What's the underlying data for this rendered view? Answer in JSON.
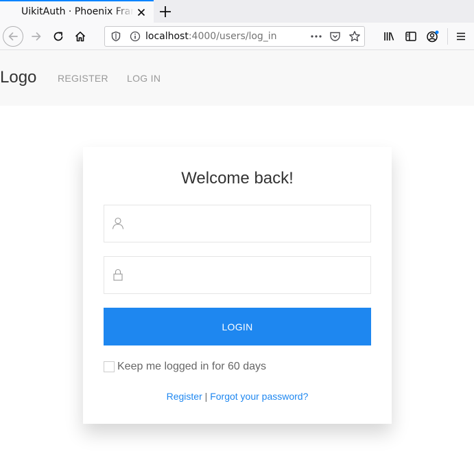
{
  "browser": {
    "tab_title": "UikitAuth · Phoenix Framework",
    "url_host": "localhost",
    "url_rest": ":4000/users/log_in",
    "accent": "#0a84ff"
  },
  "site_nav": {
    "logo": "Logo",
    "links": [
      "REGISTER",
      "LOG IN"
    ]
  },
  "login_card": {
    "title": "Welcome back!",
    "email_placeholder": "",
    "password_placeholder": "",
    "login_button": "LOGIN",
    "remember_label": "Keep me logged in for 60 days",
    "register_link": "Register",
    "separator": "|",
    "forgot_link": "Forgot your password?",
    "primary_color": "#1e87f0"
  },
  "icons": {
    "back": "arrow-left-icon",
    "forward": "arrow-right-icon",
    "reload": "reload-icon",
    "home": "home-icon",
    "shield": "tracking-shield-icon",
    "info": "info-icon",
    "more": "more-dots-icon",
    "pocket": "pocket-icon",
    "bookmark": "star-icon",
    "library": "library-icon",
    "sidebar": "sidebar-icon",
    "account": "account-icon",
    "menu": "hamburger-icon",
    "user": "user-icon",
    "lock": "lock-icon"
  }
}
